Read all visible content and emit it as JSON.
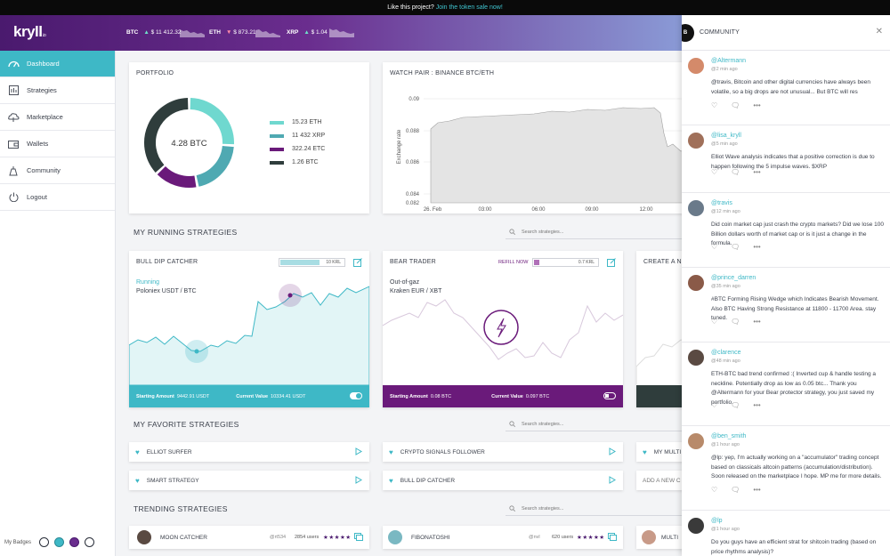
{
  "promo": {
    "text": "Like this project?",
    "link": "Join the token sale now!"
  },
  "app": {
    "logo": "kryll",
    "logo_suffix": ".io"
  },
  "tickers": [
    {
      "symbol": "BTC",
      "arrow": "▲",
      "value": "$ 11 412.32",
      "direction": "up"
    },
    {
      "symbol": "ETH",
      "arrow": "▼",
      "value": "$ 873.21",
      "direction": "down"
    },
    {
      "symbol": "XRP",
      "arrow": "▲",
      "value": "$ 1.04",
      "direction": "up"
    }
  ],
  "nav": [
    {
      "label": "Dashboard",
      "icon": "dashboard-icon"
    },
    {
      "label": "Strategies",
      "icon": "strategies-icon"
    },
    {
      "label": "Marketplace",
      "icon": "marketplace-icon"
    },
    {
      "label": "Wallets",
      "icon": "wallet-icon"
    },
    {
      "label": "Community",
      "icon": "community-icon"
    },
    {
      "label": "Logout",
      "icon": "power-icon"
    }
  ],
  "badges_label": "My Badges",
  "portfolio": {
    "title": "PORTFOLIO",
    "total": "4.28 BTC",
    "slices": [
      {
        "label": "15.23 ETH",
        "share": 0.26,
        "color": "#6fd8cf"
      },
      {
        "label": "11 432 XRP",
        "share": 0.21,
        "color": "#4fa9b2"
      },
      {
        "label": "322.24 ETC",
        "share": 0.16,
        "color": "#6a1a7a"
      },
      {
        "label": "1.26 BTC",
        "share": 0.37,
        "color": "#2f3d3c"
      }
    ]
  },
  "watch": {
    "title": "WATCH PAIR : BINANCE BTC/ETH",
    "ylabel": "Exchange rate",
    "yticks": [
      "0.09",
      "0.088",
      "0.086",
      "0.084",
      "0.082"
    ],
    "xticks": [
      "26. Feb",
      "03:00",
      "06:00",
      "09:00",
      "12:00"
    ]
  },
  "running": {
    "title": "MY RUNNING STRATEGIES",
    "search_placeholder": "Search strategies...",
    "cards": [
      {
        "name": "BULL DIP CATCHER",
        "fuel": "10 KRL",
        "status": "Running",
        "market": "Poloniex  USDT / BTC",
        "start_label": "Starting Amount",
        "start_value": "9442.91 USDT",
        "current_label": "Current Value",
        "current_value": "10334.41 USDT"
      },
      {
        "name": "BEAR TRADER",
        "refill": "REFILL NOW",
        "fuel": "0.7 KRL",
        "status": "Out-of-gaz",
        "market": "Kraken  EUR / XBT",
        "start_label": "Starting Amount",
        "start_value": "0.08 BTC",
        "current_label": "Current Value",
        "current_value": "0.097 BTC"
      },
      {
        "name": "CREATE A NE"
      }
    ]
  },
  "favorites": {
    "title": "MY FAVORITE STRATEGIES",
    "search_placeholder": "Search strategies...",
    "items": [
      "ELLIOT SURFER",
      "CRYPTO SIGNALS FOLLOWER",
      "MY MULTI",
      "SMART STRATEGY",
      "BULL DIP CATCHER",
      "ADD A NEW C"
    ]
  },
  "trending": {
    "title": "TRENDING STRATEGIES",
    "search_placeholder": "Search strategies...",
    "items": [
      {
        "name": "MOON CATCHER",
        "author": "@rt534",
        "users": "2854 users",
        "stars": "★★★★★"
      },
      {
        "name": "FIBONATOSHI",
        "author": "@nvl",
        "users": "620 users",
        "stars": "★★★★★"
      },
      {
        "name": "MULTI"
      }
    ]
  },
  "community": {
    "title": "COMMUNITY",
    "badge": "B",
    "messages": [
      {
        "user": "@Altermann",
        "time": "@2 min ago",
        "text": "@travis, Bitcoin and other digital currencies have always been volatile, so a big drops are not unusual... But BTC will res"
      },
      {
        "user": "@lisa_kryll",
        "time": "@5 min ago",
        "text": "Elliot Wave analysis indicates that a positive correction is due to happen following the 5 impulse waves. $XRP"
      },
      {
        "user": "@travis",
        "time": "@12 min ago",
        "text": "Did coin market cap just crash the crypto markets? Did we lose 100 Billion dollars worth of market cap or is it just a change in the formula."
      },
      {
        "user": "@prince_darren",
        "time": "@35 min ago",
        "text": "#BTC Forming Rising Wedge which Indicates Bearish Movement. Also BTC Having Strong Resistance at 11800 - 11700 Area. stay tuned."
      },
      {
        "user": "@clarence",
        "time": "@48 min ago",
        "text": "ETH-BTC bad trend confirmed :( Inverted cup & handle testing a neckline. Potentially drop as low as 0.05 btc... Thank you @Altermann for your Bear protector strategy, you just saved my portfolio."
      },
      {
        "user": "@ben_smith",
        "time": "@1 hour ago",
        "text": "@lp: yep, I'm actually working on a \"accumulator\" trading concept based on classicals altcoin patterns (accumulation/distribution). Soon released on the marketplace I hope. MP me for more details."
      },
      {
        "user": "@lp",
        "time": "@1 hour ago",
        "text": "Do you guys have an efficient strat for shitcoin trading (based on price rhythms analysis)?"
      }
    ]
  }
}
